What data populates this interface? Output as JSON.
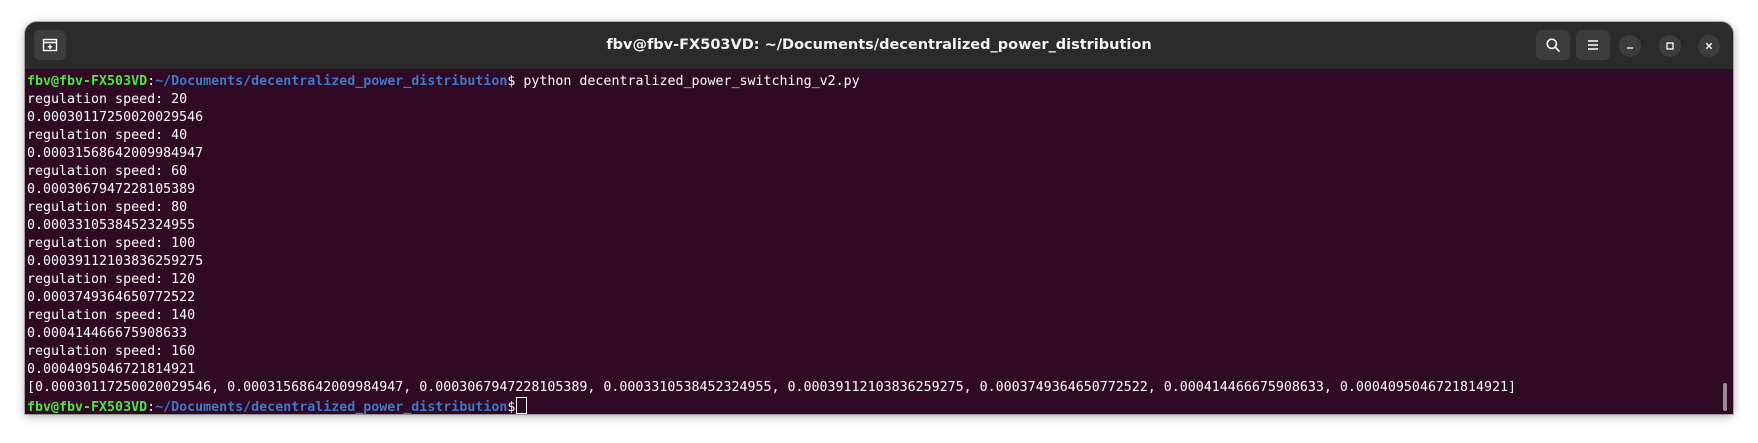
{
  "window": {
    "title": "fbv@fbv-FX503VD: ~/Documents/decentralized_power_distribution"
  },
  "titlebar": {
    "new_tab_icon": "new-tab-icon",
    "search_icon": "search-icon",
    "menu_icon": "hamburger-menu-icon",
    "minimize_icon": "minimize-icon",
    "maximize_icon": "maximize-icon",
    "close_icon": "close-icon"
  },
  "colors": {
    "terminal_bg": "#300a24",
    "prompt_user": "#4ee33d",
    "prompt_path": "#3e78c8",
    "text": "#ffffff",
    "titlebar_bg": "#2b2b2b"
  },
  "prompt": {
    "user_host": "fbv@fbv-FX503VD",
    "colon": ":",
    "path": "~/Documents/decentralized_power_distribution",
    "dollar": "$"
  },
  "terminal": {
    "command": " python decentralized_power_switching_v2.py",
    "output": [
      "regulation speed: 20",
      "0.00030117250020029546",
      "regulation speed: 40",
      "0.00031568642009984947",
      "regulation speed: 60",
      "0.0003067947228105389",
      "regulation speed: 80",
      "0.0003310538452324955",
      "regulation speed: 100",
      "0.00039112103836259275",
      "regulation speed: 120",
      "0.0003749364650772522",
      "regulation speed: 140",
      "0.000414466675908633",
      "regulation speed: 160",
      "0.0004095046721814921",
      "[0.00030117250020029546, 0.00031568642009984947, 0.0003067947228105389, 0.0003310538452324955, 0.00039112103836259275, 0.0003749364650772522, 0.000414466675908633, 0.0004095046721814921]"
    ]
  }
}
